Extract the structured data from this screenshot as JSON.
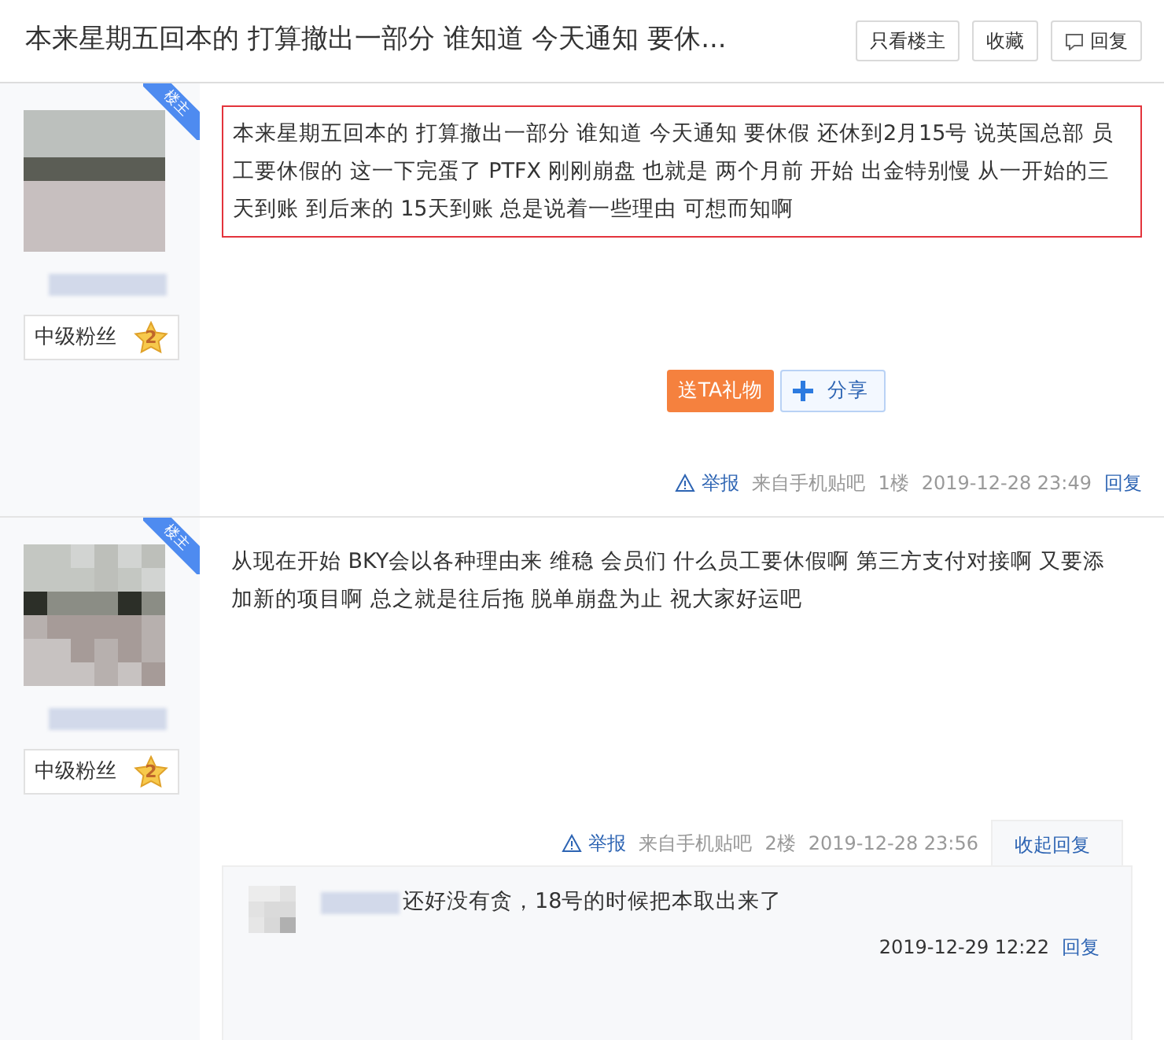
{
  "title": "本来星期五回本的 打算撤出一部分 谁知道 今天通知 要休...",
  "header_buttons": [
    {
      "label": "只看楼主",
      "kind": "plain"
    },
    {
      "label": "收藏",
      "kind": "plain"
    },
    {
      "label": "回复",
      "kind": "comment"
    }
  ],
  "posts": [
    {
      "badge": "楼主",
      "level_title": "中级粉丝",
      "level_number": "2",
      "highlighted": true,
      "content": "本来星期五回本的 打算撤出一部分 谁知道 今天通知 要休假 还休到2月15号 说英国总部 员工要休假的 这一下完蛋了 PTFX 刚刚崩盘 也就是 两个月前 开始 出金特别慢 从一开始的三天到账 到后来的 15天到账 总是说着一些理由 可想而知啊",
      "gift_button": "送TA礼物",
      "share_button": "分享",
      "report": "举报",
      "source": "来自手机贴吧",
      "floor": "1楼",
      "time": "2019-12-28 23:49",
      "reply": "回复"
    },
    {
      "badge": "楼主",
      "level_title": "中级粉丝",
      "level_number": "2",
      "highlighted": false,
      "content": "从现在开始 BKY会以各种理由来 维稳 会员们 什么员工要休假啊 第三方支付对接啊 又要添加新的项目啊 总之就是往后拖 脱单崩盘为止 祝大家好运吧",
      "report": "举报",
      "source": "来自手机贴吧",
      "floor": "2楼",
      "time": "2019-12-28 23:56",
      "reply": "收起回复",
      "replies": [
        {
          "text": "还好没有贪，18号的时候把本取出来了",
          "time": "2019-12-29 12:22",
          "reply": "回复"
        }
      ]
    }
  ]
}
